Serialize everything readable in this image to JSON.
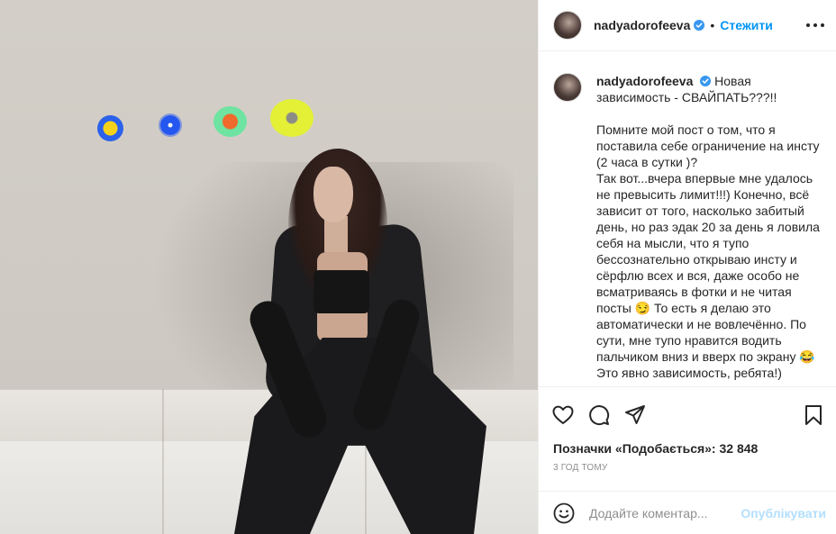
{
  "header": {
    "username": "nadyadorofeeva",
    "dot": "•",
    "follow_label": "Стежити",
    "more_icon": "more-horizontal-icon"
  },
  "caption": {
    "username": "nadyadorofeeva",
    "title": "Новая зависимость - СВАЙПАТЬ???!!",
    "body": "Помните мой пост о том, что я поставила себе ограничение на инсту (2 часа в сутки )?\nТак вот...вчера впервые мне удалось не превысить лимит!!!) Конечно, всё зависит от того, насколько забитый день, но раз эдак 20 за день я ловила себя на мысли, что я тупо бессознательно открываю инсту и сёрфлю всех и вся, даже особо не всматриваясь в фотки и не читая посты 😏 То есть я делаю это автоматически и не вовлечённо. По сути, мне тупо нравится водить пальчиком вниз и вверх по экрану 😂 Это явно зависимость, ребята!)\n..."
  },
  "actions": {
    "like_icon": "heart-icon",
    "comment_icon": "comment-icon",
    "share_icon": "paper-plane-icon",
    "save_icon": "bookmark-icon"
  },
  "likes": {
    "label": "Позначки «Подобається»:",
    "count": "32 848"
  },
  "timestamp": "3 год тому",
  "comment": {
    "placeholder": "Додайте коментар...",
    "publish_label": "Опублікувати",
    "emoji_icon": "smiley-icon"
  },
  "colors": {
    "accent": "#0095f6",
    "publish_disabled": "#b2dffc",
    "muted": "#8e8e8e",
    "text": "#262626",
    "verified": "#3897f0"
  }
}
